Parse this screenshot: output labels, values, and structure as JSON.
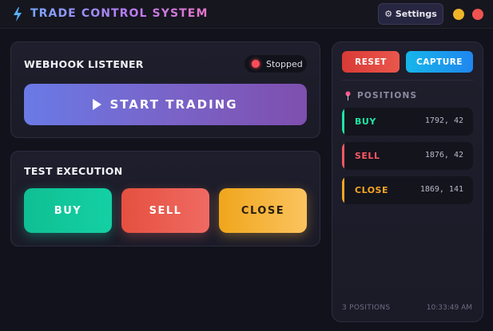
{
  "app": {
    "title": "TRADE CONTROL SYSTEM",
    "settings_label": "⚙ Settings",
    "colors": {
      "accent": "#7aa7ff",
      "minimize": "#f0b429",
      "close": "#ef5350"
    }
  },
  "webhook": {
    "title": "WEBHOOK LISTENER",
    "status": "Stopped",
    "status_color": "#ff4d5a",
    "start_label": "START TRADING"
  },
  "test_execution": {
    "title": "TEST EXECUTION",
    "buy_label": "BUY",
    "sell_label": "SELL",
    "close_label": "CLOSE"
  },
  "positions_panel": {
    "reset_label": "RESET",
    "capture_label": "CAPTURE",
    "header": "POSITIONS",
    "items": [
      {
        "type": "BUY",
        "coords": "1792, 42",
        "color": "#1ee8a2"
      },
      {
        "type": "SELL",
        "coords": "1876, 42",
        "color": "#ff5864"
      },
      {
        "type": "CLOSE",
        "coords": "1869, 141",
        "color": "#f5a623"
      }
    ],
    "count_label": "3 POSITIONS",
    "timestamp": "10:33:49 AM"
  }
}
